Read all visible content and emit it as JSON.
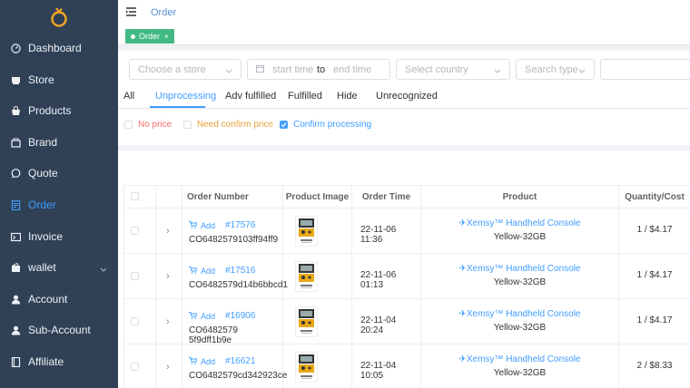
{
  "nav": {
    "items": [
      {
        "label": "Dashboard",
        "icon": "dashboard-icon"
      },
      {
        "label": "Store",
        "icon": "store-icon"
      },
      {
        "label": "Products",
        "icon": "bag-icon"
      },
      {
        "label": "Brand",
        "icon": "brand-icon"
      },
      {
        "label": "Quote",
        "icon": "chat-icon"
      },
      {
        "label": "Order",
        "icon": "document-icon"
      },
      {
        "label": "Invoice",
        "icon": "invoice-icon"
      },
      {
        "label": "wallet",
        "icon": "wallet-icon"
      },
      {
        "label": "Account",
        "icon": "user-icon"
      },
      {
        "label": "Sub-Account",
        "icon": "users-icon"
      },
      {
        "label": "Affiliate",
        "icon": "book-icon"
      }
    ],
    "active": "Order"
  },
  "header": {
    "breadcrumb": "Order"
  },
  "tags": [
    {
      "label": "Order"
    }
  ],
  "filters": {
    "store_placeholder": "Choose a store",
    "start_placeholder": "start time",
    "range_sep": "to",
    "end_placeholder": "end time",
    "country_placeholder": "Select country",
    "search_type_placeholder": "Search type"
  },
  "tabs": [
    "All",
    "Unprocessing",
    "Adv fulfilled",
    "Fulfilled",
    "Hide",
    "Unrecognized"
  ],
  "active_tab": "Unprocessing",
  "checkboxes": [
    {
      "label": "No price",
      "checked": false,
      "color": "#f56c6c"
    },
    {
      "label": "Need confirm price",
      "checked": false,
      "color": "#e6a23c"
    },
    {
      "label": "Confirm processing",
      "checked": true,
      "color": "#409eff"
    }
  ],
  "table": {
    "columns": [
      "Order Number",
      "Product Image",
      "Order Time",
      "Product",
      "Quantity/Cost"
    ],
    "add_label": "Add",
    "rows": [
      {
        "order_no": "#17576",
        "code": "CO6482579103ff94ff9",
        "time": "22-11-06 11:36",
        "product": "Xemsy™ Handheld Console",
        "variant": "Yellow-32GB",
        "qty": "1 / $4.17"
      },
      {
        "order_no": "#17516",
        "code": "CO6482579d14b6bbcd1",
        "time": "22-11-06 01:13",
        "product": "Xemsy™ Handheld Console",
        "variant": "Yellow-32GB",
        "qty": "1 / $4.17"
      },
      {
        "order_no": "#16906",
        "code": "CO6482579 5f9dff1b9e",
        "time": "22-11-04 20:24",
        "product": "Xemsy™ Handheld Console",
        "variant": "Yellow-32GB",
        "qty": "1 / $4.17"
      },
      {
        "order_no": "#16621",
        "code": "CO6482579cd342923ce",
        "time": "22-11-04 10:05",
        "product": "Xemsy™ Handheld Console",
        "variant": "Yellow-32GB",
        "qty": "2 / $8.33"
      }
    ]
  },
  "colors": {
    "sidebar": "#304156",
    "accent": "#409eff",
    "tag": "#42b983",
    "logo": "#f5a623"
  }
}
